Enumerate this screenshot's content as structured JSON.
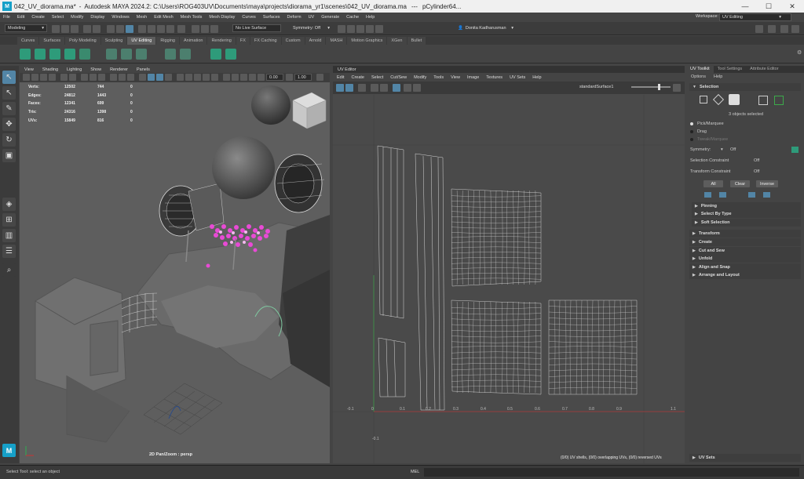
{
  "title_bar": {
    "logo": "M",
    "file_tab": "042_UV_diorama.ma*",
    "app_title": "Autodesk MAYA 2024.2: C:\\Users\\ROG403UV\\Documents\\maya\\projects\\diorama_yr1\\scenes\\042_UV_diorama.ma",
    "separator": "---",
    "object": "pCylinder64...",
    "minimize": "—",
    "maximize": "☐",
    "close": "✕"
  },
  "menu_bar": {
    "items": [
      "File",
      "Edit",
      "Create",
      "Select",
      "Modify",
      "Display",
      "Windows",
      "Mesh",
      "Edit Mesh",
      "Mesh Tools",
      "Mesh Display",
      "Curves",
      "Surfaces",
      "Deform",
      "UV",
      "Generate",
      "Cache",
      "Help"
    ],
    "workspace_label": "Workspace:",
    "workspace_value": "UV Editing"
  },
  "status_line": {
    "mode": "Modeling",
    "live_surface": "No Live Surface",
    "symmetry": "Symmetry: Off",
    "user": "Donita Kadharusman"
  },
  "shelf_tabs": [
    "Curves",
    "Surfaces",
    "Poly Modeling",
    "Sculpting",
    "UV Editing",
    "Rigging",
    "Animation",
    "Rendering",
    "FX",
    "FX Caching",
    "Custom",
    "Arnold",
    "MASH",
    "Motion Graphics",
    "XGen",
    "Bullet"
  ],
  "active_shelf_tab": "UV Editing",
  "viewport": {
    "menu": [
      "View",
      "Shading",
      "Lighting",
      "Show",
      "Renderer",
      "Panels"
    ],
    "field_a": "0.00",
    "field_b": "1.00",
    "hud": [
      {
        "label": "Verts:",
        "a": "12502",
        "b": "744",
        "c": "0"
      },
      {
        "label": "Edges:",
        "a": "24812",
        "b": "1443",
        "c": "0"
      },
      {
        "label": "Faces:",
        "a": "12341",
        "b": "699",
        "c": "0"
      },
      {
        "label": "Tris:",
        "a": "24316",
        "b": "1398",
        "c": "0"
      },
      {
        "label": "UVs:",
        "a": "15849",
        "b": "816",
        "c": "0"
      }
    ],
    "camera_label": "2D Pan/Zoom : persp"
  },
  "uv_editor": {
    "title": "UV Editor",
    "menu": [
      "Edit",
      "Create",
      "Select",
      "Cut/Sew",
      "Modify",
      "Tools",
      "View",
      "Image",
      "Textures",
      "UV Sets",
      "Help"
    ],
    "material": "standardSurface1",
    "axis_labels": [
      "0.1",
      "0.2",
      "0.3",
      "0.4",
      "0.5",
      "0.6",
      "0.7",
      "0.8",
      "0.9",
      "1.1"
    ],
    "left_labels": [
      "-0.1",
      "0",
      "-0.1"
    ],
    "status": "(0/0) UV shells, (0/0) overlapping UVs, (0/0) reversed UVs"
  },
  "right_panel": {
    "tabs": [
      "UV Toolkit",
      "Tool Settings",
      "Attribute Editor"
    ],
    "menu": [
      "Options",
      "Help"
    ],
    "selection_header": "Selection",
    "objects_selected": "3 objects selected",
    "radio": [
      "Pick/Marquee",
      "Drag",
      "Tweak/Marquee"
    ],
    "symmetry_label": "Symmetry:",
    "symmetry_value": "Off",
    "selection_constraint_label": "Selection Constraint",
    "selection_constraint_value": "Off",
    "transform_constraint_label": "Transform Constraint",
    "transform_constraint_value": "Off",
    "buttons": [
      "All",
      "Clear",
      "Inverse"
    ],
    "sub_sections": [
      "Pinning",
      "Select By Type",
      "Soft Selection"
    ],
    "sections": [
      "Transform",
      "Create",
      "Cut and Sew",
      "Unfold",
      "Align and Snap",
      "Arrange and Layout"
    ],
    "uv_sets": "UV Sets"
  },
  "bottom": {
    "help": "Select Tool: select an object",
    "mel": "MEL"
  },
  "colors": {
    "accent": "#5285a6",
    "viewport_bg": "#5e5e5e",
    "uv_bg": "#4a4a4a",
    "pink": "#e94ad6"
  }
}
